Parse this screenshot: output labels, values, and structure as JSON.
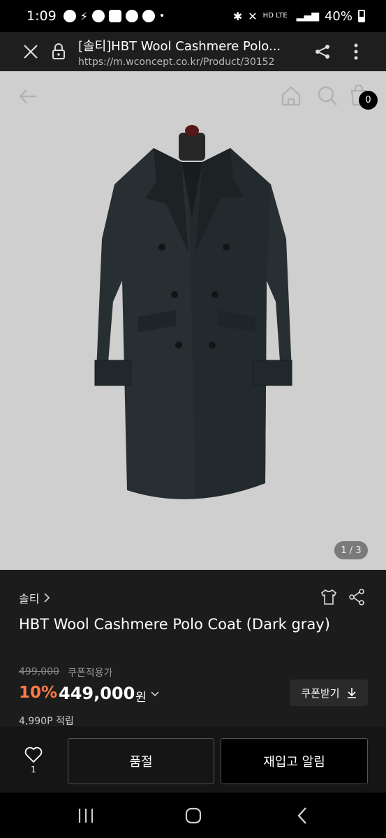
{
  "status_bar": {
    "time": "1:09",
    "network": "HD LTE",
    "battery": "40%"
  },
  "browser": {
    "title": "[솔티]HBT Wool Cashmere Polo...",
    "url": "https://m.wconcept.co.kr/Product/30152"
  },
  "hero": {
    "cart_count": "0",
    "page_indicator": "1 / 3"
  },
  "product": {
    "brand": "솔티",
    "name": "HBT Wool Cashmere Polo Coat (Dark gray)",
    "original_price": "499,000",
    "coupon_label": "쿠폰적용가",
    "discount": "10%",
    "price": "449,000",
    "currency": "원",
    "coupon_button": "쿠폰받기",
    "points": "4,990P 적립"
  },
  "actions": {
    "like_count": "1",
    "soldout_label": "품절",
    "restock_label": "재입고 알림"
  },
  "colors": {
    "accent": "#ff7a45",
    "panel": "#1c1c1c",
    "hero_bg": "#dcdcdc"
  }
}
